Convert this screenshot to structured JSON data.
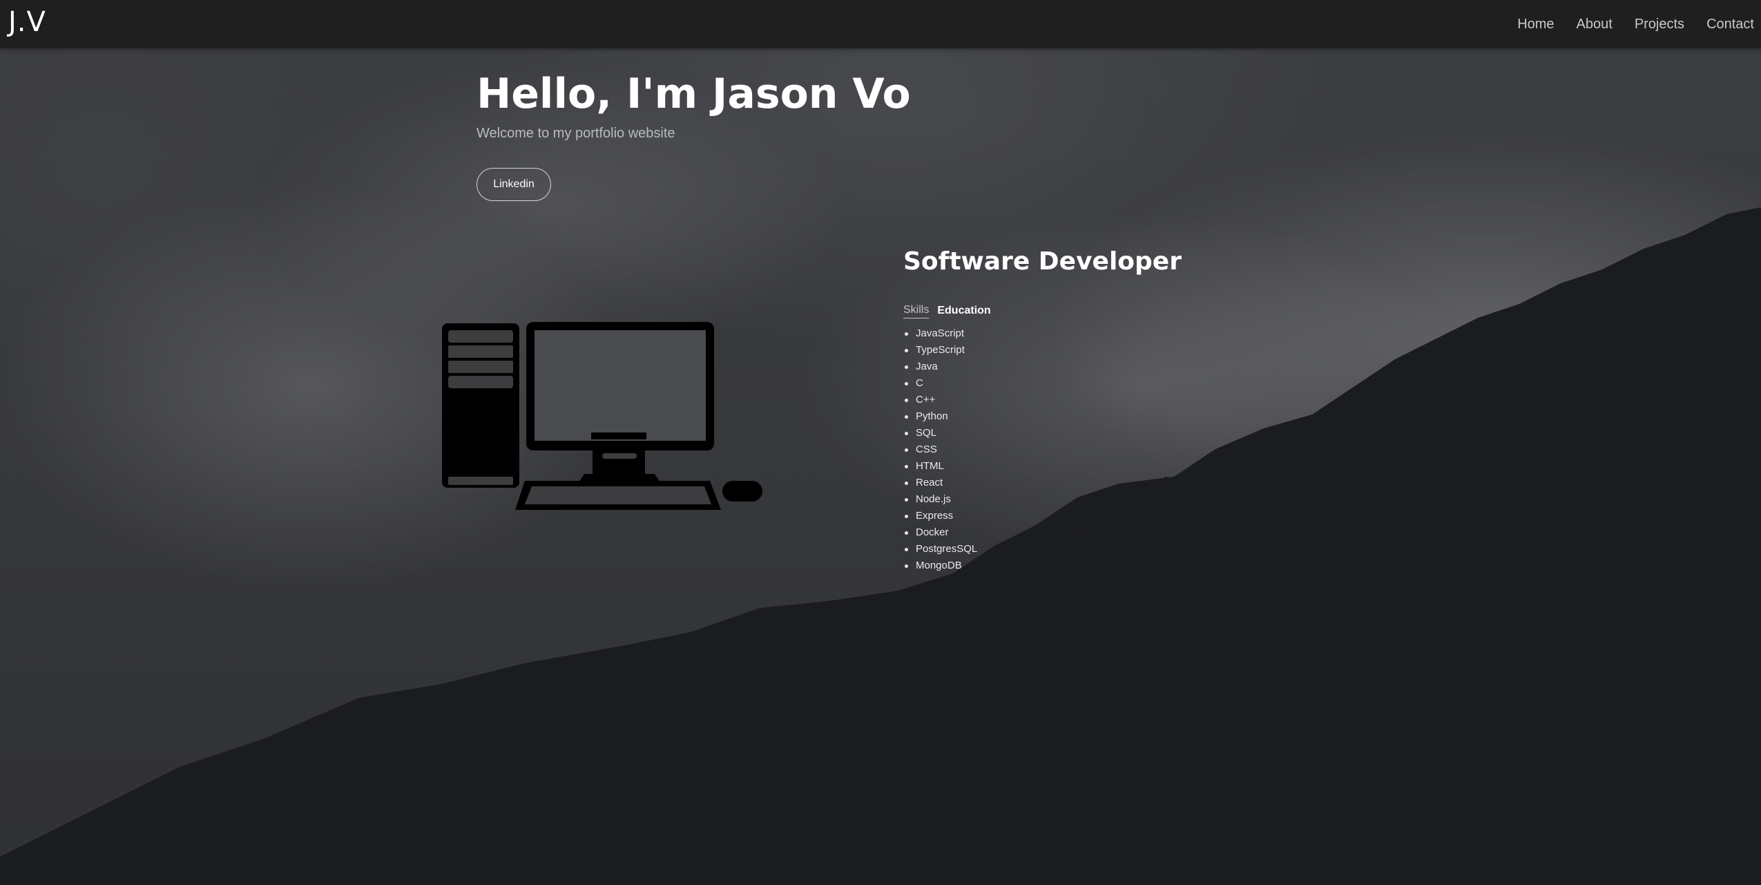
{
  "nav": {
    "brand": "J.V",
    "links": [
      "Home",
      "About",
      "Projects",
      "Contact"
    ]
  },
  "hero": {
    "title": "Hello, I'm Jason Vo",
    "subtitle": "Welcome to my portfolio website",
    "linkedin_label": "Linkedin"
  },
  "illustration": {
    "icon": "desktop-computer-icon"
  },
  "developer": {
    "title": "Software Developer",
    "tabs": [
      {
        "label": "Skills",
        "active": true
      },
      {
        "label": "Education",
        "active": false
      }
    ],
    "skills": [
      "JavaScript",
      "TypeScript",
      "Java",
      "C",
      "C++",
      "Python",
      "SQL",
      "CSS",
      "HTML",
      "React",
      "Node.js",
      "Express",
      "Docker",
      "PostgresSQL",
      "MongoDB"
    ]
  },
  "colors": {
    "navbar": "#1f1f1f",
    "text": "#ffffff",
    "subtext": "#b9bbbe"
  }
}
